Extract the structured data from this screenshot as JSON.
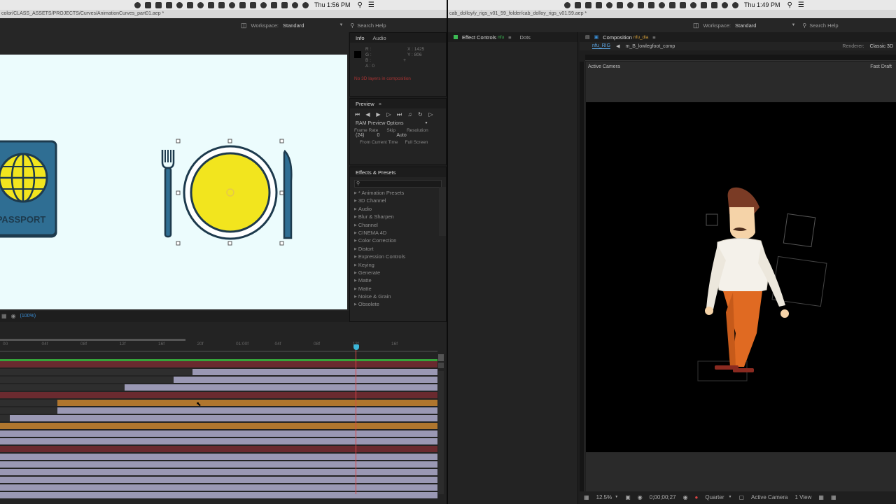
{
  "left_screen": {
    "menubar": {
      "time": "Thu 1:56 PM"
    },
    "path_title": "color/CLASS_ASSETS/PROJECTS/Curves/AnimationCurves_part01.aep *",
    "toolbar": {
      "workspace_label": "Workspace:",
      "workspace_value": "Standard",
      "search_label": "Search Help"
    },
    "info_panel": {
      "tabs": [
        "Info",
        "Audio"
      ],
      "rgb_labels": [
        "R :",
        "G :",
        "B :",
        "A : 0"
      ],
      "x_label": "X : 1425",
      "y_label": "Y : 806",
      "plus": "+",
      "warning": "No 3D layers in composition"
    },
    "preview_panel": {
      "title": "Preview",
      "ram_options": "RAM Preview Options",
      "frame_rate_label": "Frame Rate",
      "skip_label": "Skip",
      "resolution_label": "Resolution",
      "frame_rate_value": "(24)",
      "skip_value": "0",
      "resolution_value": "Auto",
      "from_current": "From Current Time",
      "full_screen": "Full Screen"
    },
    "effects_panel": {
      "title": "Effects & Presets",
      "items": [
        "* Animation Presets",
        "3D Channel",
        "Audio",
        "Blur & Sharpen",
        "Channel",
        "CINEMA 4D",
        "Color Correction",
        "Distort",
        "Expression Controls",
        "Keying",
        "Generate",
        "Matte",
        "Matte",
        "Noise & Grain",
        "Obsolete"
      ]
    },
    "viewer": {
      "passport_text": "PASSPORT",
      "zoom_text": "(100%)"
    },
    "timeline": {
      "ticks": [
        "00",
        "04f",
        "08f",
        "12f",
        "16f",
        "20f",
        "01:00f",
        "04f",
        "08f",
        "12f",
        "16f"
      ]
    }
  },
  "right_screen": {
    "menubar": {
      "time": "Thu 1:49 PM"
    },
    "path_title": "cab_dolloy/y_rigs_v01_59_folder/cab_dolloy_rigs_v01.59.aep *",
    "toolbar": {
      "workspace_label": "Workspace:",
      "workspace_value": "Standard",
      "search_label": "Search Help"
    },
    "effect_controls": {
      "tab": "Effect Controls",
      "tab_suffix": "nfu",
      "tab2": "Dots"
    },
    "composition": {
      "tab": "Composition",
      "tab_suffix": "nfu_dia",
      "breadcrumb": [
        "nfu_RIG",
        "m_B_lowlegfoot_comp"
      ],
      "renderer_label": "Renderer:",
      "renderer_value": "Classic 3D",
      "active_camera": "Active Camera",
      "fast_draft": "Fast Draft"
    },
    "statusbar": {
      "zoom": "12.5%",
      "timecode": "0;00;00;27",
      "quality": "Quarter",
      "camera": "Active Camera",
      "view": "1 View"
    }
  },
  "colors": {
    "accent_blue": "#2d8ceb",
    "timeline_red": "#6a2a2f",
    "timeline_orange": "#b0762e",
    "timeline_lavender": "#9a98b4",
    "plate_yellow": "#f2e51e",
    "passport_blue": "#2f6e93"
  }
}
